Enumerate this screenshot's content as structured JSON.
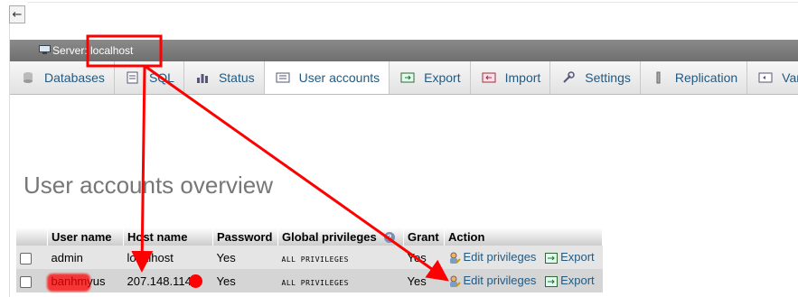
{
  "window": {
    "back_label": "←"
  },
  "server": {
    "label": "Server: localhost"
  },
  "tabs": [
    {
      "label": "Databases",
      "icon": "database-icon"
    },
    {
      "label": "SQL",
      "icon": "sql-icon"
    },
    {
      "label": "Status",
      "icon": "status-icon"
    },
    {
      "label": "User accounts",
      "icon": "user-accounts-icon"
    },
    {
      "label": "Export",
      "icon": "export-icon"
    },
    {
      "label": "Import",
      "icon": "import-icon"
    },
    {
      "label": "Settings",
      "icon": "settings-icon"
    },
    {
      "label": "Replication",
      "icon": "replication-icon"
    },
    {
      "label": "Vari",
      "icon": "variables-icon"
    }
  ],
  "main": {
    "title": "User accounts overview"
  },
  "table": {
    "headers": {
      "user": "User name",
      "host": "Host name",
      "password": "Password",
      "global": "Global privileges",
      "grant": "Grant",
      "action": "Action"
    },
    "rows": [
      {
        "user": "admin",
        "host": "localhost",
        "password": "Yes",
        "privileges": "ALL PRIVILEGES",
        "grant": "Yes",
        "edit": "Edit privileges",
        "export": "Export"
      },
      {
        "user": "banhmyus",
        "host": "207.148.114.",
        "password": "Yes",
        "privileges": "ALL PRIVILEGES",
        "grant": "Yes",
        "edit": "Edit privileges",
        "export": "Export"
      }
    ]
  },
  "colors": {
    "annotation": "#ff0000",
    "link": "#235a81",
    "server_bar": "#7a7a7a"
  }
}
